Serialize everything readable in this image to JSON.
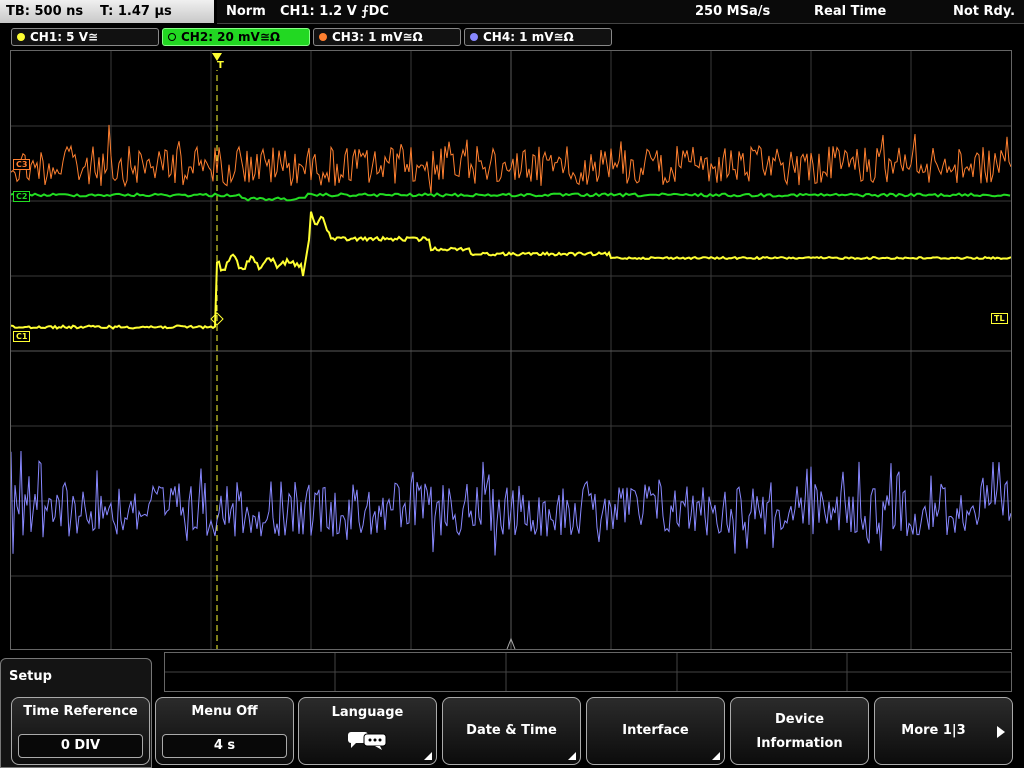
{
  "header": {
    "timebase": "TB: 500 ns",
    "trigger_time": "T: 1.47 µs",
    "mode": "Norm",
    "trigger": "CH1: 1.2 V ⨍DC",
    "sample_rate": "250 MSa/s",
    "acq_mode": "Real Time",
    "status": "Not Rdy."
  },
  "channels": [
    {
      "label": "CH1: 5 V≅",
      "color": "#ffff33"
    },
    {
      "label": "CH2: 20 mV≅Ω",
      "color": "#22dd22"
    },
    {
      "label": "CH3: 1 mV≅Ω",
      "color": "#ff8030"
    },
    {
      "label": "CH4: 1 mV≅Ω",
      "color": "#8888ff"
    }
  ],
  "markers": {
    "c1": "C1",
    "c2": "C2",
    "c3": "C3",
    "trigger_level": "TL",
    "trigger_pos": "T"
  },
  "menu": {
    "title": "Setup",
    "softkeys": [
      {
        "label": "Time Reference",
        "value": "0 DIV"
      },
      {
        "label": "Menu Off",
        "value": "4 s"
      },
      {
        "label": "Language"
      },
      {
        "label": "Date & Time"
      },
      {
        "label": "Interface"
      },
      {
        "label": "Device",
        "label2": "Information"
      },
      {
        "label": "More 1|3"
      }
    ]
  }
}
